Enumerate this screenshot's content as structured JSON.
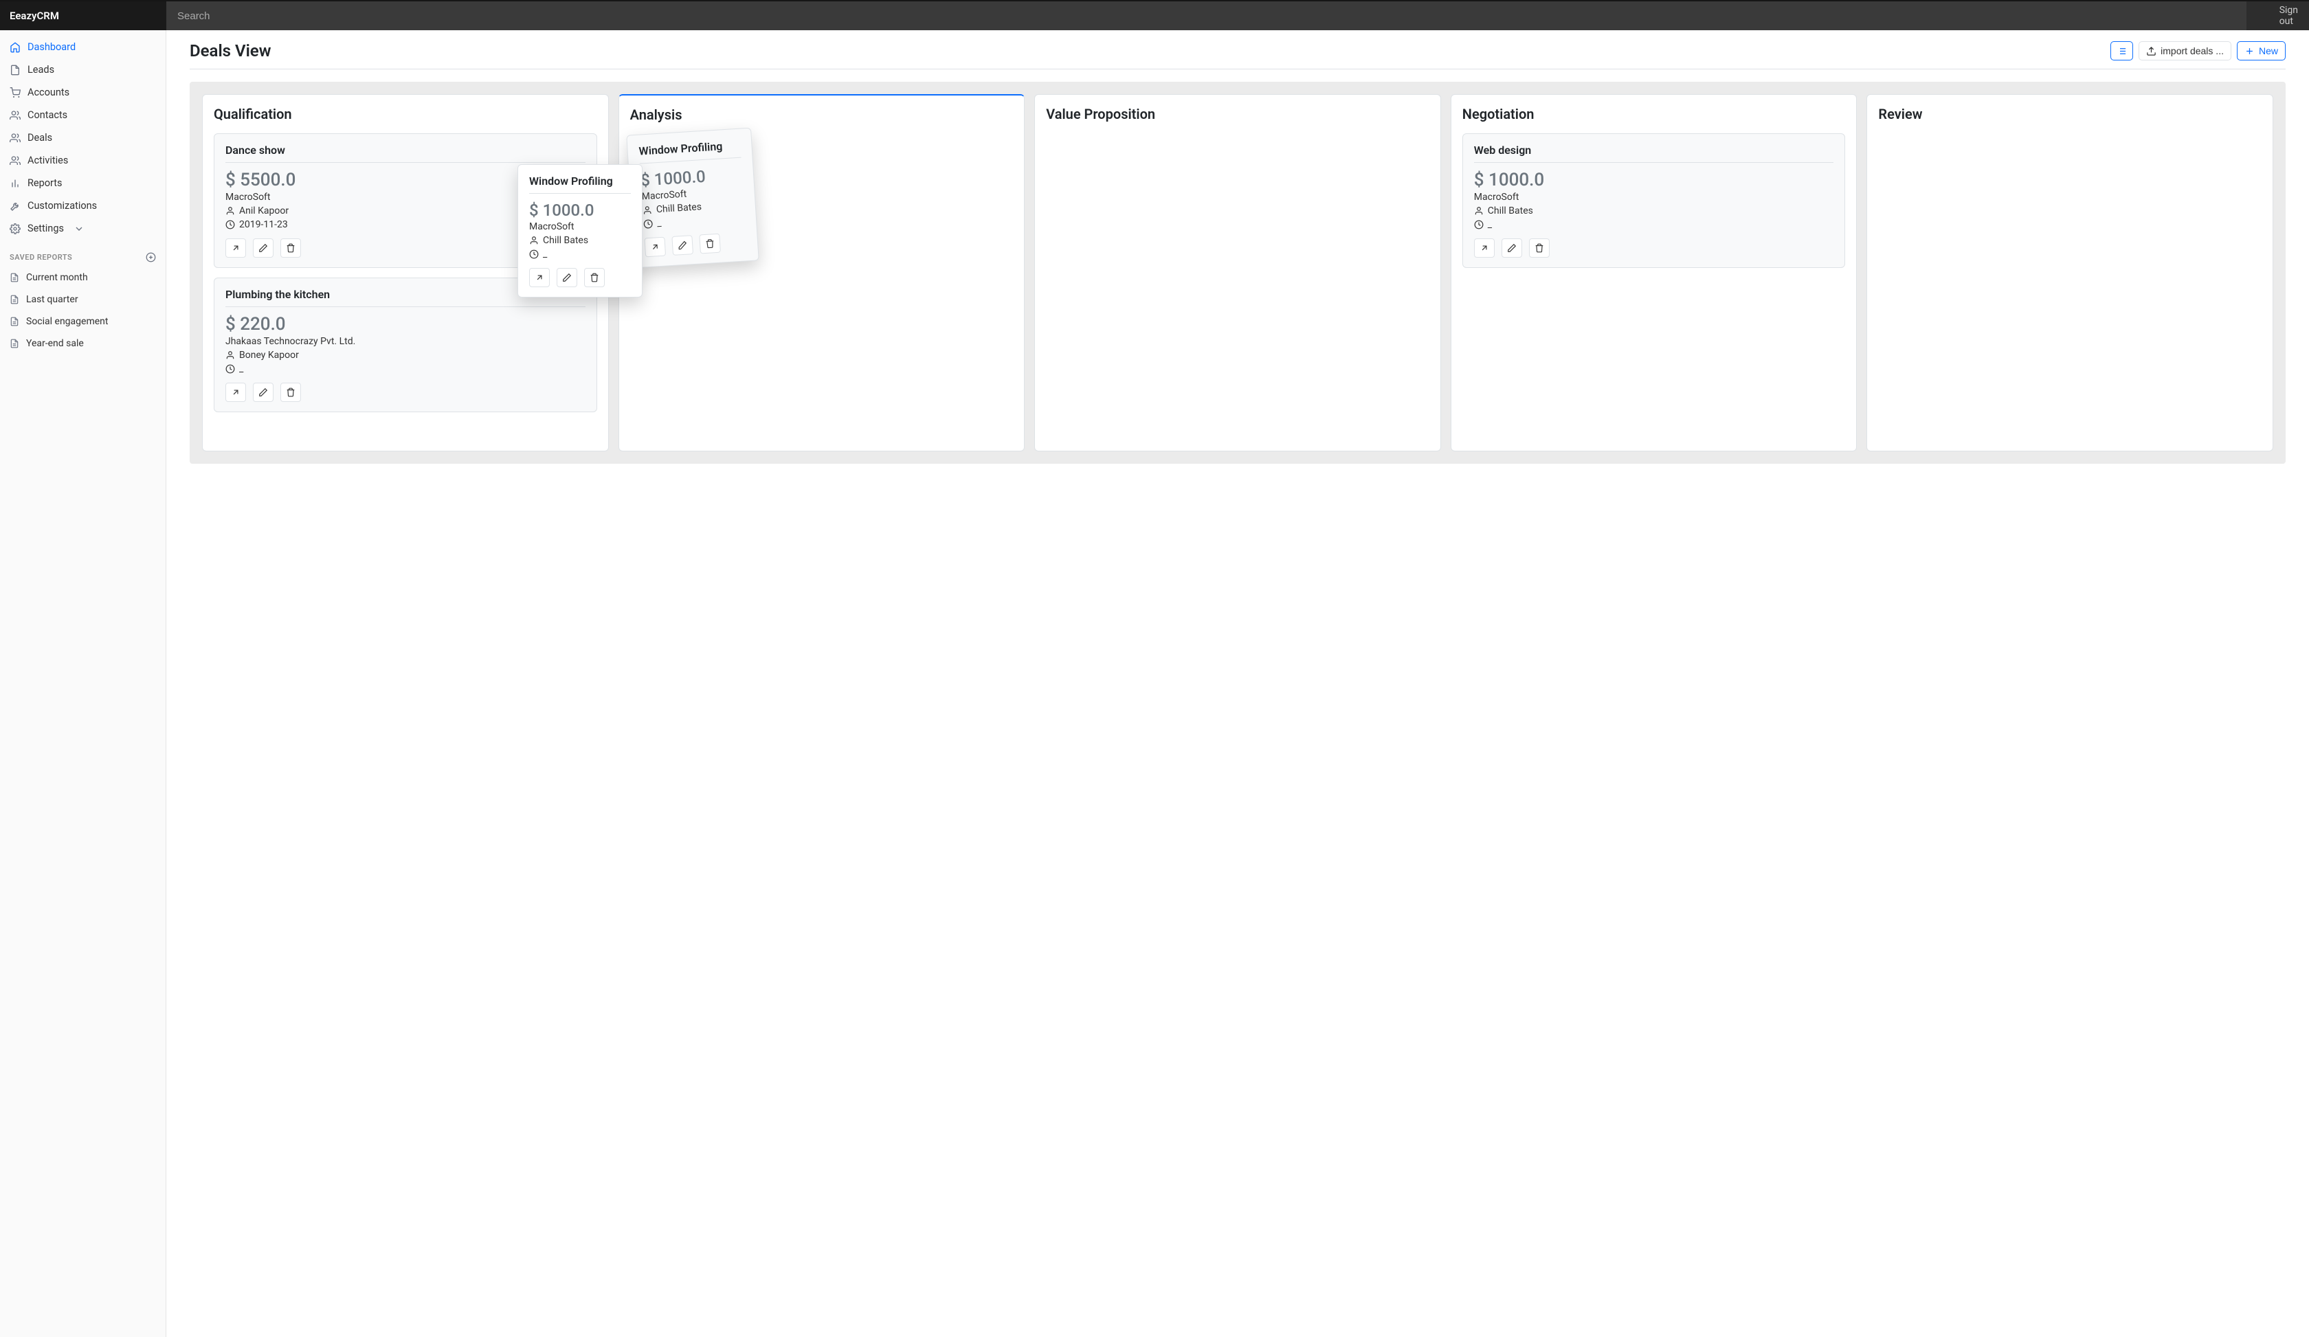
{
  "app": {
    "name": "EeazyCRM"
  },
  "search": {
    "placeholder": "Search"
  },
  "signout": {
    "label": "Sign out"
  },
  "nav": {
    "items": [
      {
        "label": "Dashboard",
        "icon": "home",
        "active": true
      },
      {
        "label": "Leads",
        "icon": "file"
      },
      {
        "label": "Accounts",
        "icon": "cart"
      },
      {
        "label": "Contacts",
        "icon": "users"
      },
      {
        "label": "Deals",
        "icon": "users"
      },
      {
        "label": "Activities",
        "icon": "users"
      },
      {
        "label": "Reports",
        "icon": "bars"
      },
      {
        "label": "Customizations",
        "icon": "wrench"
      },
      {
        "label": "Settings",
        "icon": "gear",
        "has_submenu": true
      }
    ]
  },
  "saved_reports": {
    "header": "SAVED REPORTS",
    "items": [
      {
        "label": "Current month"
      },
      {
        "label": "Last quarter"
      },
      {
        "label": "Social engagement"
      },
      {
        "label": "Year-end sale"
      }
    ]
  },
  "page": {
    "title": "Deals View",
    "buttons": {
      "import": "import deals ...",
      "new": "New"
    }
  },
  "board": {
    "columns": [
      {
        "title": "Qualification",
        "highlight": false
      },
      {
        "title": "Analysis",
        "highlight": true
      },
      {
        "title": "Value Proposition",
        "highlight": false
      },
      {
        "title": "Negotiation",
        "highlight": false
      },
      {
        "title": "Review",
        "highlight": false
      }
    ],
    "cards": {
      "qualification": [
        {
          "title": "Dance show",
          "price": "$ 5500.0",
          "company": "MacroSoft",
          "owner": "Anil Kapoor",
          "date": "2019-11-23"
        },
        {
          "title": "Plumbing the kitchen",
          "price": "$ 220.0",
          "company": "Jhakaas Technocrazy Pvt. Ltd.",
          "owner": "Boney Kapoor",
          "date": "_"
        }
      ],
      "negotiation": [
        {
          "title": "Web design",
          "price": "$ 1000.0",
          "company": "MacroSoft",
          "owner": "Chill Bates",
          "date": "_"
        }
      ]
    },
    "dragging_ghost": {
      "title": "Window Profiling",
      "price": "$ 1000.0",
      "company": "MacroSoft",
      "owner": "Chill Bates",
      "date": "_"
    },
    "dragging_card": {
      "title": "Window Profiling",
      "price": "$ 1000.0",
      "company": "MacroSoft",
      "owner": "Chill Bates",
      "date": "_"
    }
  }
}
